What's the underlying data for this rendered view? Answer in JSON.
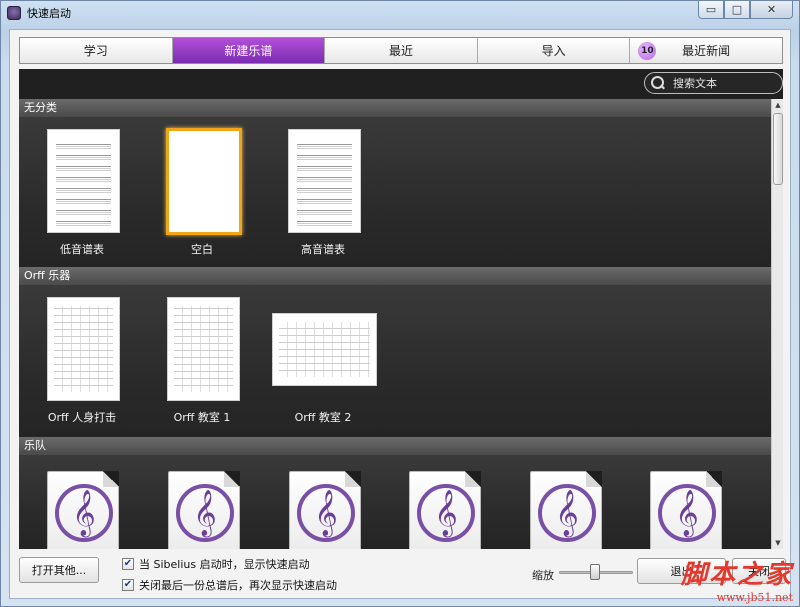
{
  "window": {
    "title": "快速启动"
  },
  "tabs": [
    {
      "label": "学习",
      "active": false
    },
    {
      "label": "新建乐谱",
      "active": true
    },
    {
      "label": "最近",
      "active": false
    },
    {
      "label": "导入",
      "active": false
    },
    {
      "label": "最近新闻",
      "active": false,
      "badge": "10"
    }
  ],
  "search": {
    "placeholder": "搜索文本"
  },
  "sections": [
    {
      "title": "无分类",
      "items": [
        "低音谱表",
        "空白",
        "高音谱表"
      ],
      "selected": "空白"
    },
    {
      "title": "Orff 乐器",
      "items": [
        "Orff 人身打击",
        "Orff 教室 1",
        "Orff 教室 2"
      ]
    },
    {
      "title": "乐队",
      "items": [
        "",
        "",
        "",
        "",
        "",
        ""
      ]
    }
  ],
  "footer": {
    "open_other": "打开其他...",
    "checkbox1": {
      "label": "当 Sibelius 启动时，显示快速启动",
      "checked": true
    },
    "checkbox2": {
      "label": "关闭最后一份总谱后，再次显示快速启动",
      "checked": true
    },
    "zoom_label": "缩放",
    "exit_label": "退出",
    "close_label": "关闭"
  },
  "watermark": {
    "main": "脚本之家",
    "url": "www.jb51.net"
  },
  "colors": {
    "accent_purple": "#8c36c4",
    "selection": "#f2a516"
  }
}
